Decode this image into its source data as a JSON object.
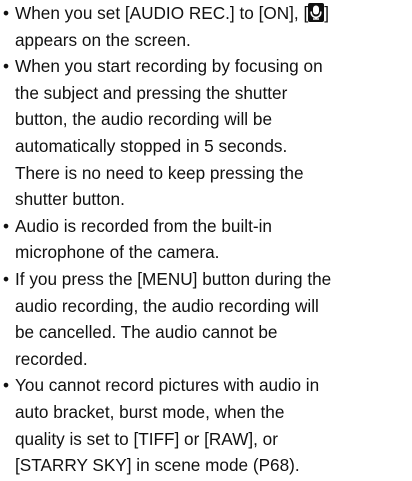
{
  "bullet_char": "•",
  "items": [
    {
      "line1_pre": "When you set [AUDIO REC.] to [ON], [",
      "line1_icon": "microphone-icon",
      "line1_post": "]",
      "line2": "appears on the screen."
    },
    {
      "lines": [
        "When you start recording by focusing on",
        "the subject and pressing the shutter",
        "button, the audio recording will be",
        "automatically stopped in 5 seconds.",
        "There is no need to keep pressing the",
        "shutter button."
      ]
    },
    {
      "lines": [
        "Audio is recorded from the built-in",
        "microphone of the camera."
      ]
    },
    {
      "lines": [
        "If you press the [MENU] button during the",
        "audio recording, the audio recording will",
        "be cancelled. The audio cannot be",
        "recorded."
      ]
    },
    {
      "lines": [
        "You cannot record pictures with audio in",
        "auto bracket, burst mode, when the",
        "quality is set to [TIFF] or [RAW], or",
        "[STARRY SKY] in scene mode (P68)."
      ]
    }
  ]
}
